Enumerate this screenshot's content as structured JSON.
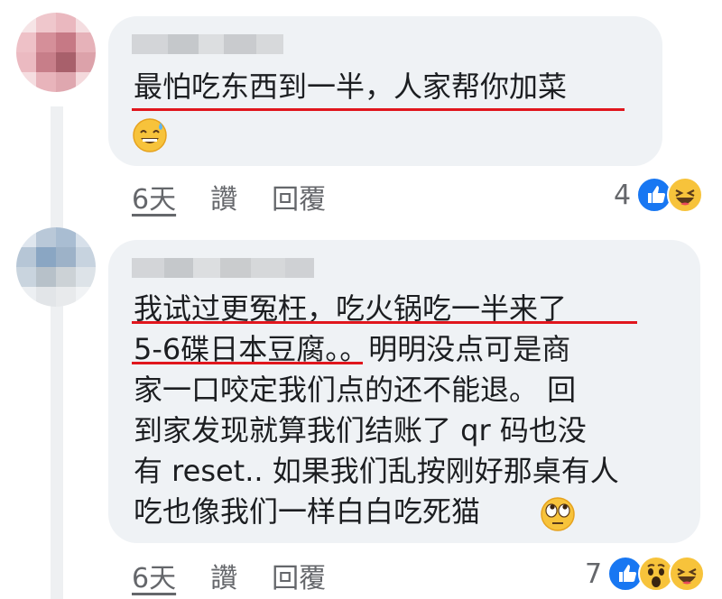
{
  "comments": [
    {
      "lines": [
        "最怕吃东西到一半，人家帮你加菜"
      ],
      "timestamp": "6天",
      "like_label": "讚",
      "reply_label": "回覆",
      "reaction_count": "4",
      "reactions": [
        "like-icon",
        "haha-icon"
      ],
      "emoji": "sweat-smile-emoji"
    },
    {
      "lines": [
        "我试过更冤枉，吃火锅吃一半来了",
        "5-6碟日本豆腐。。明明没点可是商",
        "家一口咬定我们点的还不能退。 回",
        "到家发现就算我们结账了 qr 码也没",
        "有 reset.. 如果我们乱按刚好那桌有人",
        "吃也像我们一样白白吃死猫"
      ],
      "timestamp": "6天",
      "like_label": "讚",
      "reply_label": "回覆",
      "reaction_count": "7",
      "reactions": [
        "like-icon",
        "wow-icon",
        "haha-icon"
      ],
      "emoji": "eye-roll-emoji"
    }
  ],
  "colors": {
    "bubble": "#eff2f5",
    "underline": "#e0161d",
    "like_blue": "#1877f2",
    "emoji_yellow": "#f7c33b",
    "muted_text": "#65676b"
  }
}
